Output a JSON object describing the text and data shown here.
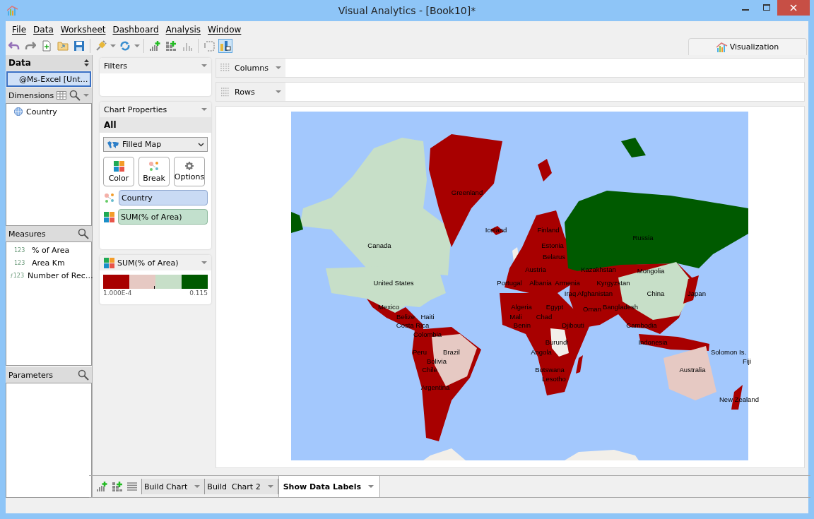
{
  "window": {
    "title": "Visual Analytics - [Book10]*"
  },
  "menu": [
    "File",
    "Data",
    "Worksheet",
    "Dashboard",
    "Analysis",
    "Window"
  ],
  "view_tab": {
    "label": "Visualization",
    "selected": true
  },
  "data_panel": {
    "title": "Data",
    "source": {
      "label": "@Ms-Excel [Unt…",
      "selected": true
    }
  },
  "dimensions": {
    "title": "Dimensions",
    "items": [
      "Country"
    ]
  },
  "measures": {
    "title": "Measures",
    "items": [
      {
        "label": "% of Area",
        "tag": "123",
        "kind": "number"
      },
      {
        "label": "Area Km",
        "tag": "123",
        "kind": "number"
      },
      {
        "label": "Number of Rec…",
        "tag": "123",
        "kind": "calculated"
      }
    ]
  },
  "parameters": {
    "title": "Parameters"
  },
  "filters": {
    "title": "Filters"
  },
  "chart_properties": {
    "title": "Chart Properties",
    "section": "All",
    "chart_type": "Filled Map",
    "buttons": [
      "Color",
      "Break",
      "Options"
    ],
    "shelves": [
      {
        "label": "Country",
        "kind": "break"
      },
      {
        "label": "SUM(% of Area)",
        "kind": "color"
      }
    ]
  },
  "legend": {
    "title": "SUM(% of Area)",
    "swatches": [
      {
        "color": "#a80000"
      },
      {
        "color": "#e6c9c3"
      },
      {
        "color": "#c7dfc8"
      },
      {
        "color": "#005a00"
      }
    ],
    "min": "1.000E-4",
    "max": "0.115"
  },
  "columns_shelf": {
    "label": "Columns"
  },
  "rows_shelf": {
    "label": "Rows"
  },
  "map": {
    "labels": [
      "Greenland",
      "Iceland",
      "Finland",
      "Russia",
      "Canada",
      "Estonia",
      "Belarus",
      "Austria",
      "Kazakhstan",
      "Mongolia",
      "United States",
      "Portugal",
      "Albania",
      "Armenia",
      "Kyrgyzstan",
      "Iraq",
      "Afghanistan",
      "China",
      "Japan",
      "Mexico",
      "Algeria",
      "Egypt",
      "Oman",
      "Bangladesh",
      "Belize",
      "Haiti",
      "Mali",
      "Chad",
      "Costa Rica",
      "Benin",
      "Djibouti",
      "Cambodia",
      "Colombia",
      "Burundi",
      "Indonesia",
      "Peru",
      "Brazil",
      "Angola",
      "Solomon Is.",
      "Bolivia",
      "Fiji",
      "Chile",
      "Botswana",
      "Australia",
      "Lesotho",
      "Argentina",
      "New Zealand"
    ]
  },
  "sheet_tabs": [
    {
      "label": "Build Chart",
      "selected": false
    },
    {
      "label": "Build  Chart 2",
      "selected": false
    },
    {
      "label": "Show Data Labels",
      "selected": true
    }
  ]
}
